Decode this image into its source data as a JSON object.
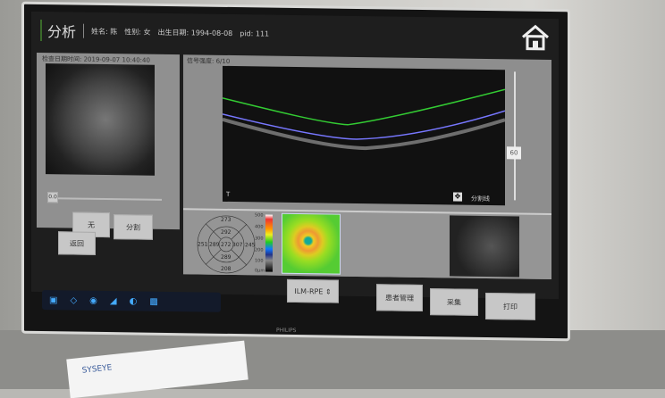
{
  "header": {
    "title": "分析",
    "name": "姓名: 陈",
    "gender": "性别: 女",
    "birth": "出生日期: 1994-08-08",
    "pid": "pid: 111"
  },
  "left": {
    "exam_time": "检查日期时间: 2019-09-07 10:40:40",
    "slider_value": "0.0",
    "buttons": {
      "none": "无",
      "segment": "分割"
    },
    "back": "返回"
  },
  "oct": {
    "signal": "信号强度: 6/10",
    "slider_value": "60",
    "segment_line": "分割线",
    "scan_label": "T"
  },
  "sectors": {
    "top_outer": "273",
    "top_inner": "292",
    "left_outer": "251",
    "left_inner": "289",
    "center": "272",
    "right_inner": "307",
    "right_outer": "245",
    "bottom_inner": "289",
    "bottom_outer": "208"
  },
  "scale": [
    "500",
    "400",
    "300",
    "200",
    "100",
    "0μm"
  ],
  "layer_select": "ILM-RPE",
  "actions": {
    "patients": "患者管理",
    "capture": "采集",
    "print": "打印"
  },
  "monitor": {
    "brand": "PHILIPS"
  },
  "card": "SYSEYE"
}
